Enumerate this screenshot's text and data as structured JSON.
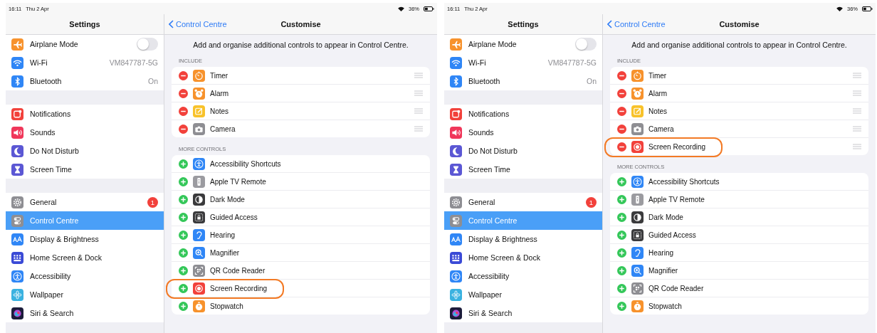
{
  "screens": [
    {
      "status_bar": {
        "time": "16:11",
        "date": "Thu 2 Apr",
        "battery": "36%"
      },
      "sidebar": {
        "title": "Settings",
        "groups": [
          [
            {
              "kind": "airplane",
              "label": "Airplane Mode",
              "toggle_on": false,
              "selected": false
            },
            {
              "kind": "wifi",
              "label": "Wi-Fi",
              "value": "VM847787-5G",
              "selected": false
            },
            {
              "kind": "bluetooth",
              "label": "Bluetooth",
              "value": "On",
              "selected": false
            }
          ],
          [
            {
              "kind": "notifications",
              "label": "Notifications",
              "selected": false
            },
            {
              "kind": "sounds",
              "label": "Sounds",
              "selected": false
            },
            {
              "kind": "moon",
              "label": "Do Not Disturb",
              "selected": false
            },
            {
              "kind": "hourglass",
              "label": "Screen Time",
              "selected": false
            }
          ],
          [
            {
              "kind": "gear",
              "label": "General",
              "badge": "1",
              "selected": false
            },
            {
              "kind": "switches",
              "label": "Control Centre",
              "selected": true
            },
            {
              "kind": "textsize",
              "label": "Display & Brightness",
              "selected": false
            },
            {
              "kind": "grid",
              "label": "Home Screen & Dock",
              "selected": false
            },
            {
              "kind": "accessibility",
              "label": "Accessibility",
              "selected": false
            },
            {
              "kind": "flower",
              "label": "Wallpaper",
              "selected": false
            },
            {
              "kind": "siri",
              "label": "Siri & Search",
              "selected": false
            }
          ]
        ]
      },
      "detail": {
        "back": "Control Centre",
        "title": "Customise",
        "description": "Add and organise additional controls to appear in Control Centre.",
        "sections": [
          {
            "header": "INCLUDE",
            "kind": "include",
            "items": [
              {
                "kind": "timer",
                "label": "Timer",
                "highlighted": false
              },
              {
                "kind": "alarm",
                "label": "Alarm",
                "highlighted": false
              },
              {
                "kind": "notes",
                "label": "Notes",
                "highlighted": false
              },
              {
                "kind": "camera",
                "label": "Camera",
                "highlighted": false
              }
            ]
          },
          {
            "header": "MORE CONTROLS",
            "kind": "more",
            "items": [
              {
                "kind": "accessibility",
                "label": "Accessibility Shortcuts",
                "highlighted": false
              },
              {
                "kind": "remote",
                "label": "Apple TV Remote",
                "highlighted": false
              },
              {
                "kind": "darkmode",
                "label": "Dark Mode",
                "highlighted": false
              },
              {
                "kind": "lock",
                "label": "Guided Access",
                "highlighted": false
              },
              {
                "kind": "ear",
                "label": "Hearing",
                "highlighted": false
              },
              {
                "kind": "magnifier",
                "label": "Magnifier",
                "highlighted": false
              },
              {
                "kind": "qr",
                "label": "QR Code Reader",
                "highlighted": false
              },
              {
                "kind": "record",
                "label": "Screen Recording",
                "highlighted": true
              },
              {
                "kind": "stopwatch",
                "label": "Stopwatch",
                "highlighted": false
              }
            ]
          }
        ]
      }
    },
    {
      "status_bar": {
        "time": "16:11",
        "date": "Thu 2 Apr",
        "battery": "36%"
      },
      "sidebar": {
        "title": "Settings",
        "groups": [
          [
            {
              "kind": "airplane",
              "label": "Airplane Mode",
              "toggle_on": false,
              "selected": false
            },
            {
              "kind": "wifi",
              "label": "Wi-Fi",
              "value": "VM847787-5G",
              "selected": false
            },
            {
              "kind": "bluetooth",
              "label": "Bluetooth",
              "value": "On",
              "selected": false
            }
          ],
          [
            {
              "kind": "notifications",
              "label": "Notifications",
              "selected": false
            },
            {
              "kind": "sounds",
              "label": "Sounds",
              "selected": false
            },
            {
              "kind": "moon",
              "label": "Do Not Disturb",
              "selected": false
            },
            {
              "kind": "hourglass",
              "label": "Screen Time",
              "selected": false
            }
          ],
          [
            {
              "kind": "gear",
              "label": "General",
              "badge": "1",
              "selected": false
            },
            {
              "kind": "switches",
              "label": "Control Centre",
              "selected": true
            },
            {
              "kind": "textsize",
              "label": "Display & Brightness",
              "selected": false
            },
            {
              "kind": "grid",
              "label": "Home Screen & Dock",
              "selected": false
            },
            {
              "kind": "accessibility",
              "label": "Accessibility",
              "selected": false
            },
            {
              "kind": "flower",
              "label": "Wallpaper",
              "selected": false
            },
            {
              "kind": "siri",
              "label": "Siri & Search",
              "selected": false
            }
          ]
        ]
      },
      "detail": {
        "back": "Control Centre",
        "title": "Customise",
        "description": "Add and organise additional controls to appear in Control Centre.",
        "sections": [
          {
            "header": "INCLUDE",
            "kind": "include",
            "items": [
              {
                "kind": "timer",
                "label": "Timer",
                "highlighted": false
              },
              {
                "kind": "alarm",
                "label": "Alarm",
                "highlighted": false
              },
              {
                "kind": "notes",
                "label": "Notes",
                "highlighted": false
              },
              {
                "kind": "camera",
                "label": "Camera",
                "highlighted": false
              },
              {
                "kind": "record",
                "label": "Screen Recording",
                "highlighted": true
              }
            ]
          },
          {
            "header": "MORE CONTROLS",
            "kind": "more",
            "items": [
              {
                "kind": "accessibility",
                "label": "Accessibility Shortcuts",
                "highlighted": false
              },
              {
                "kind": "remote",
                "label": "Apple TV Remote",
                "highlighted": false
              },
              {
                "kind": "darkmode",
                "label": "Dark Mode",
                "highlighted": false
              },
              {
                "kind": "lock",
                "label": "Guided Access",
                "highlighted": false
              },
              {
                "kind": "ear",
                "label": "Hearing",
                "highlighted": false
              },
              {
                "kind": "magnifier",
                "label": "Magnifier",
                "highlighted": false
              },
              {
                "kind": "qr",
                "label": "QR Code Reader",
                "highlighted": false
              },
              {
                "kind": "stopwatch",
                "label": "Stopwatch",
                "highlighted": false
              }
            ]
          }
        ]
      }
    }
  ]
}
